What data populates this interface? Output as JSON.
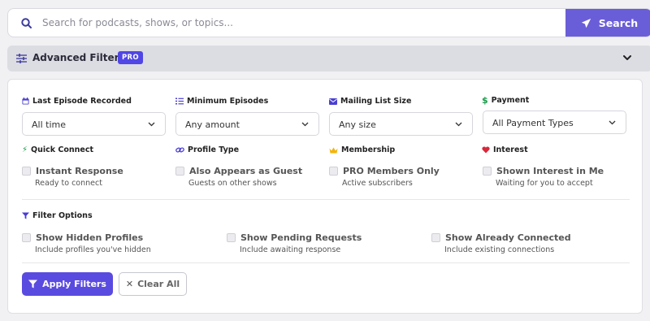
{
  "search": {
    "placeholder": "Search for podcasts, shows, or topics...",
    "button_label": "Search"
  },
  "advanced_filters": {
    "title": "Advanced Filters",
    "badge": "PRO"
  },
  "dropdowns": [
    {
      "label": "Last Episode Recorded",
      "icon": "calendar-icon",
      "value": "All time"
    },
    {
      "label": "Minimum Episodes",
      "icon": "list-icon",
      "value": "Any amount"
    },
    {
      "label": "Mailing List Size",
      "icon": "envelope-icon",
      "value": "Any size"
    },
    {
      "label": "Payment",
      "icon": "dollar-icon",
      "value": "All Payment Types"
    }
  ],
  "checkbox_groups": [
    {
      "label": "Quick Connect",
      "icon": "bolt-icon",
      "option": "Instant Response",
      "description": "Ready to connect",
      "checked": false
    },
    {
      "label": "Profile Type",
      "icon": "link-icon",
      "option": "Also Appears as Guest",
      "description": "Guests on other shows",
      "checked": false
    },
    {
      "label": "Membership",
      "icon": "crown-icon",
      "option": "PRO Members Only",
      "description": "Active subscribers",
      "checked": false
    },
    {
      "label": "Interest",
      "icon": "heart-icon",
      "option": "Shown Interest in Me",
      "description": "Waiting for you to accept",
      "checked": false
    }
  ],
  "filter_options": {
    "label": "Filter Options",
    "items": [
      {
        "option": "Show Hidden Profiles",
        "description": "Include profiles you've hidden",
        "checked": false
      },
      {
        "option": "Show Pending Requests",
        "description": "Include awaiting response",
        "checked": false
      },
      {
        "option": "Show Already Connected",
        "description": "Include existing connections",
        "checked": false
      }
    ]
  },
  "actions": {
    "apply_label": "Apply Filters",
    "clear_label": "Clear All"
  },
  "colors": {
    "accent": "#5a4be0",
    "search_button": "#6a5ed8",
    "dollar": "#1a9a4a",
    "bolt": "#1a9a4a",
    "crown": "#f2b40a",
    "heart": "#d9273a"
  }
}
